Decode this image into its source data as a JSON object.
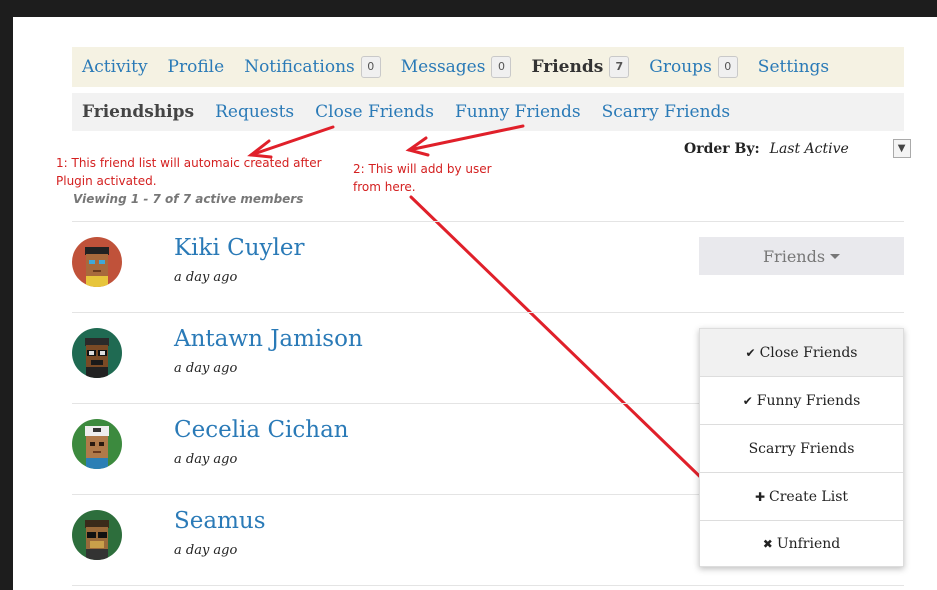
{
  "main_nav": [
    {
      "label": "Activity"
    },
    {
      "label": "Profile"
    },
    {
      "label": "Notifications",
      "count": "0"
    },
    {
      "label": "Messages",
      "count": "0"
    },
    {
      "label": "Friends",
      "count": "7",
      "active": true
    },
    {
      "label": "Groups",
      "count": "0"
    },
    {
      "label": "Settings"
    }
  ],
  "sub_nav": [
    {
      "label": "Friendships",
      "active": true
    },
    {
      "label": "Requests"
    },
    {
      "label": "Close Friends"
    },
    {
      "label": "Funny Friends"
    },
    {
      "label": "Scarry Friends"
    }
  ],
  "order_by": {
    "label": "Order By:",
    "value": "Last Active"
  },
  "viewing": "Viewing 1 - 7 of 7 active members",
  "annotations": {
    "note1": "1:  This friend list will automaic created after Plugin activated.",
    "note2": "2: This will add by user from here."
  },
  "members": [
    {
      "name": "Kiki Cuyler",
      "time": "a day ago"
    },
    {
      "name": "Antawn Jamison",
      "time": "a day ago"
    },
    {
      "name": "Cecelia Cichan",
      "time": "a day ago"
    },
    {
      "name": "Seamus",
      "time": "a day ago"
    }
  ],
  "friends_button": {
    "label": "Friends"
  },
  "dropdown": [
    {
      "label": "Close Friends",
      "icon": "check-icon",
      "glyph": "✔"
    },
    {
      "label": "Funny Friends",
      "icon": "check-icon",
      "glyph": "✔"
    },
    {
      "label": "Scarry Friends",
      "icon": "",
      "glyph": ""
    },
    {
      "label": "Create List",
      "icon": "plus-icon",
      "glyph": "✚"
    },
    {
      "label": "Unfriend",
      "icon": "close-icon",
      "glyph": "✖"
    }
  ],
  "colors": {
    "link": "#2a7ab7",
    "annotation": "#d42020",
    "nav_bg": "#f5f2e3"
  }
}
